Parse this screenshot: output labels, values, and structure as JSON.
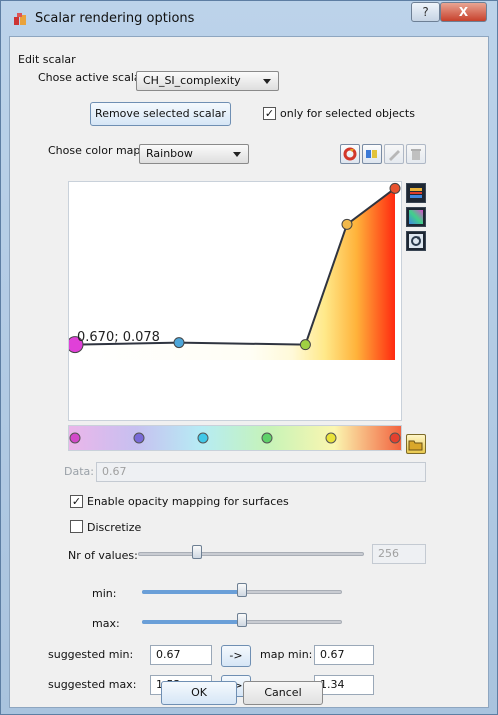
{
  "window": {
    "title": "Scalar rendering options",
    "help_glyph": "?",
    "close_glyph": "X"
  },
  "edit_scalar": {
    "group_label": "Edit scalar",
    "active_scalar_label": "Chose active scalar",
    "active_scalar_value": "CH_SI_complexity",
    "remove_button": "Remove selected scalar",
    "only_selected_label": "only for selected objects",
    "only_selected_checked": true
  },
  "color_map": {
    "label": "Chose color map",
    "value": "Rainbow",
    "cursor_readout": "0.670; 0.078",
    "opacity_curve": [
      [
        0.0,
        0.078
      ],
      [
        0.325,
        0.09
      ],
      [
        0.72,
        0.078
      ],
      [
        0.85,
        0.78
      ],
      [
        1.0,
        0.99
      ]
    ],
    "gradient_stops": [
      "#d24ac9",
      "#7a6bd8",
      "#40c8e8",
      "#5fd16a",
      "#e8e23a",
      "#e3402e"
    ],
    "stop_positions": [
      0.0,
      0.2,
      0.4,
      0.6,
      0.8,
      1.0
    ]
  },
  "data_field": {
    "label": "Data:",
    "value": "0.67"
  },
  "opacity_mapping": {
    "label": "Enable opacity mapping for surfaces",
    "checked": true
  },
  "discretize": {
    "label": "Discretize",
    "checked": false
  },
  "nr_values": {
    "label": "Nr of values:",
    "value": "256",
    "slider_fraction": 0.26
  },
  "min_slider": {
    "label": "min:",
    "fraction": 0.5
  },
  "max_slider": {
    "label": "max:",
    "fraction": 0.5
  },
  "suggested_min": {
    "label": "suggested min:",
    "value": "0.67"
  },
  "suggested_max": {
    "label": "suggested max:",
    "value": "1.52"
  },
  "map_min": {
    "label": "map min:",
    "value": "0.67"
  },
  "map_max": {
    "label": "map max:",
    "value": "1.34"
  },
  "apply_arrow": "->",
  "ok_button": "OK",
  "cancel_button": "Cancel"
}
